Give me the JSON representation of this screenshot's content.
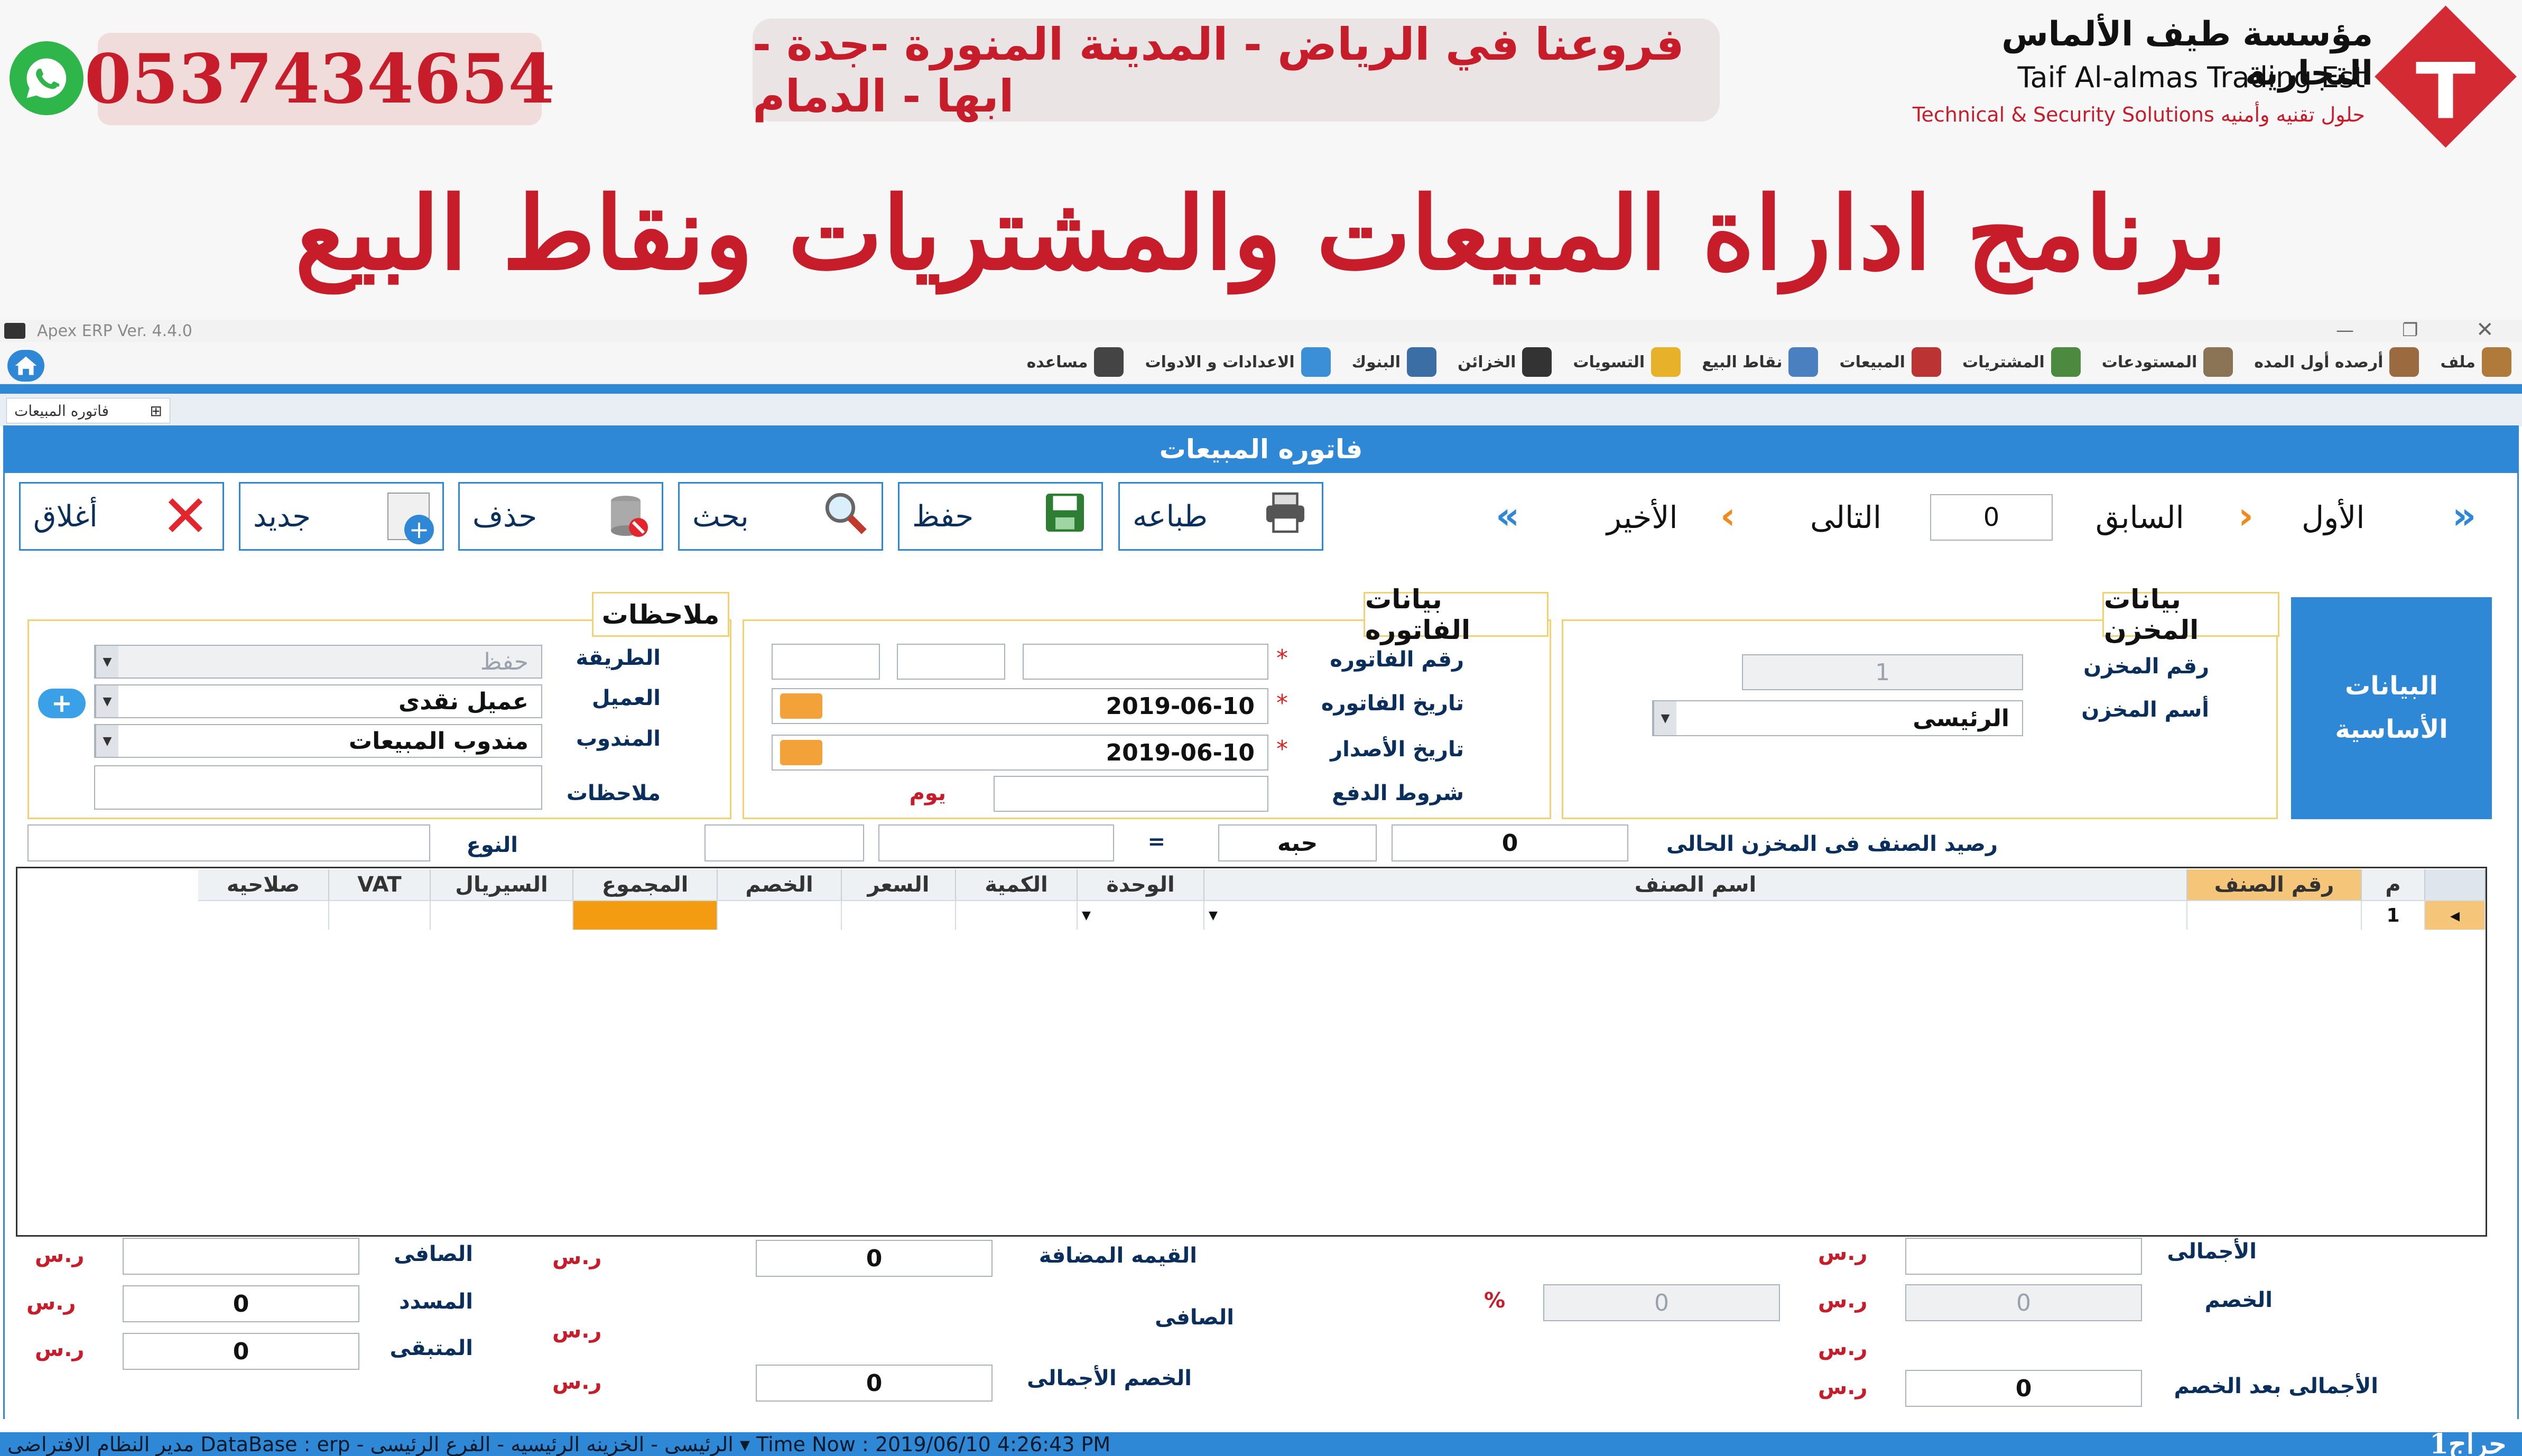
{
  "banner": {
    "phone": "0537434654",
    "branches": "فروعنا في الرياض - المدينة المنورة -جدة - ابها - الدمام",
    "company_ar": "مؤسسة طيف الألماس التجارية",
    "company_en": "Taif Al-almas Trading Est",
    "company_sub": "Technical & Security Solutions حلول تقنيه وأمنيه",
    "title": "برنامج اداراة المبيعات والمشتريات ونقاط البيع"
  },
  "window": {
    "title": "Apex ERP Ver. 4.4.0"
  },
  "menu": [
    {
      "label": "ملف",
      "color": "#b07a3a"
    },
    {
      "label": "أرصده أول المده",
      "color": "#9b6b3f"
    },
    {
      "label": "المستودعات",
      "color": "#8b7355"
    },
    {
      "label": "المشتريات",
      "color": "#4c8b3f"
    },
    {
      "label": "المبيعات",
      "color": "#b33"
    },
    {
      "label": "نقاط البيع",
      "color": "#4a7fc0"
    },
    {
      "label": "التسويات",
      "color": "#e7b12a"
    },
    {
      "label": "الخزائن",
      "color": "#333"
    },
    {
      "label": "البنوك",
      "color": "#3b6ea5"
    },
    {
      "label": "الاعدادات و الادوات",
      "color": "#3a8fd6"
    },
    {
      "label": "مساعده",
      "color": "#444"
    }
  ],
  "tab": {
    "label": "فاتوره المبيعات",
    "pin": "⊞"
  },
  "form_title": "فاتوره المبيعات",
  "toolbar": {
    "close": "أغلاق",
    "new": "جديد",
    "delete": "حذف",
    "search": "بحث",
    "save": "حفظ",
    "print": "طباعه"
  },
  "nav": {
    "first": "الأول",
    "prev": "السابق",
    "record": "0",
    "next": "التالى",
    "last": "الأخير"
  },
  "basics_tab": "البيانات الأساسية",
  "store": {
    "title": "بيانات المخزن",
    "number_label": "رقم المخزن",
    "number": "1",
    "name_label": "أسم المخزن",
    "name": "الرئيسى"
  },
  "invoice": {
    "title": "بيانات الفاتوره",
    "number_label": "رقم الفاتوره",
    "date_label": "تاريخ الفاتوره",
    "date": "2019-06-10",
    "issue_label": "تاريخ الأصدار",
    "issue": "2019-06-10",
    "terms_label": "شروط الدفع",
    "day": "يوم"
  },
  "notes": {
    "title": "ملاحظات",
    "method_label": "الطريقة",
    "method": "حفظ",
    "customer_label": "العميل",
    "customer": "عميل نقدى",
    "rep_label": "المندوب",
    "rep": "مندوب المبيعات",
    "notes_label": "ملاحظات"
  },
  "balance": {
    "label": "رصيد الصنف فى المخزن الحالى",
    "value": "0",
    "unit": "حبه",
    "eq": "=",
    "type_label": "النوع"
  },
  "grid": {
    "headers": [
      "م",
      "رقم الصنف",
      "اسم الصنف",
      "الوحدة",
      "الكمية",
      "السعر",
      "الخصم",
      "المجموع",
      "السيريال",
      "VAT",
      "صلاحيه"
    ],
    "row": [
      "1"
    ]
  },
  "totals": {
    "total_label": "الأجمالى",
    "discount_label": "الخصم",
    "discount": "0",
    "discount_pct": "0",
    "pct": "%",
    "after_label": "الأجمالى بعد الخصم",
    "after": "0",
    "vat_label": "القيمه المضافة",
    "vat": "0",
    "net_mid_label": "الصافى",
    "total_disc_label": "الخصم الأجمالى",
    "total_disc": "0",
    "net_label": "الصافى",
    "paid_label": "المسدد",
    "paid": "0",
    "remain_label": "المتبقى",
    "remain": "0",
    "currency": "ر.س"
  },
  "status": {
    "text": "مدير النظام الافتراضى   DataBase : erp  -  الرئيسى  -  الخزينه الرئيسيه  -  الفرع الرئيسى   ▾ Time Now :   2019/06/10 4:26:43 PM",
    "page_tag": "1حراج"
  }
}
